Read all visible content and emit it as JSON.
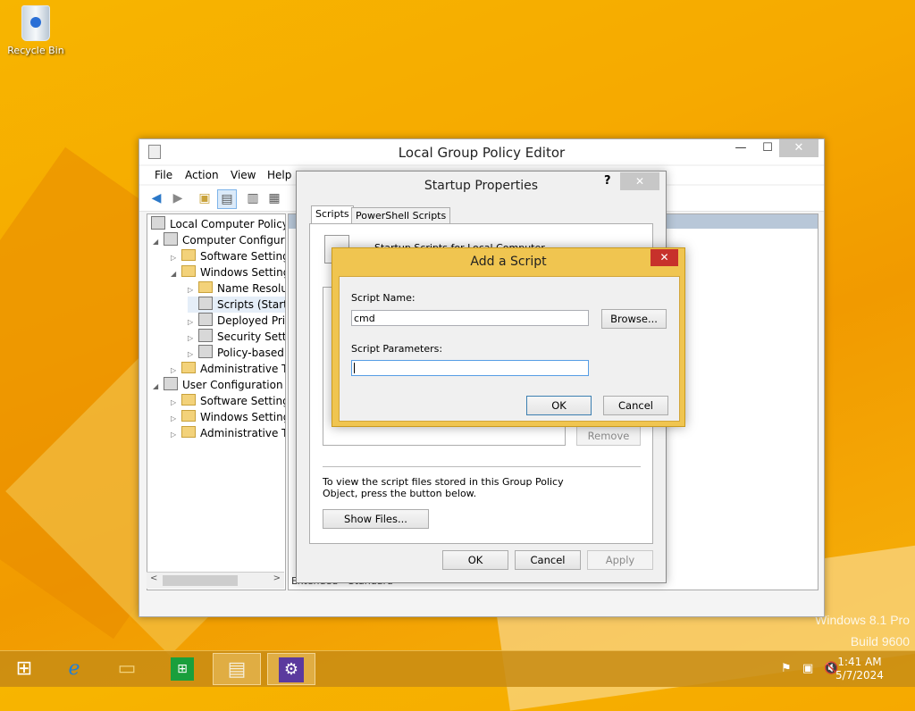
{
  "desktop": {
    "recycle_bin_label": "Recycle Bin",
    "watermark_line1": "Windows 8.1 Pro",
    "watermark_line2": "Build 9600"
  },
  "gpe": {
    "title": "Local Group Policy Editor",
    "minimize": "—",
    "maximize": "☐",
    "close": "✕",
    "menu": [
      "File",
      "Action",
      "View",
      "Help"
    ],
    "tree": [
      {
        "label": "Local Computer Policy"
      },
      {
        "label": "Computer Configura"
      },
      {
        "label": "Software Settings"
      },
      {
        "label": "Windows Setting"
      },
      {
        "label": "Name Resolut"
      },
      {
        "label": "Scripts (Startu"
      },
      {
        "label": "Deployed Prir"
      },
      {
        "label": "Security Settir"
      },
      {
        "label": "Policy-based"
      },
      {
        "label": "Administrative Te"
      },
      {
        "label": "User Configuration"
      },
      {
        "label": "Software Settings"
      },
      {
        "label": "Windows Setting"
      },
      {
        "label": "Administrative Te"
      }
    ],
    "bottom_tabs": [
      "Extended",
      "Standard"
    ]
  },
  "startup": {
    "title": "Startup Properties",
    "help": "?",
    "close": "✕",
    "tabs": [
      "Scripts",
      "PowerShell Scripts"
    ],
    "heading": "Startup Scripts for Local Computer",
    "remove": "Remove",
    "note": "To view the script files stored in this Group Policy Object, press the button below.",
    "show_files": "Show Files...",
    "ok": "OK",
    "cancel": "Cancel",
    "apply": "Apply"
  },
  "add_script": {
    "title": "Add a Script",
    "close": "✕",
    "script_name_label": "Script Name:",
    "script_name_value": "cmd",
    "browse": "Browse...",
    "script_params_label": "Script Parameters:",
    "script_params_value": "",
    "ok": "OK",
    "cancel": "Cancel"
  },
  "taskbar": {
    "time": "1:41 AM",
    "date": "5/7/2024",
    "items": [
      "start-icon",
      "ie-icon",
      "file-explorer-icon",
      "store-icon",
      "notepad-icon",
      "settings-icon"
    ]
  }
}
